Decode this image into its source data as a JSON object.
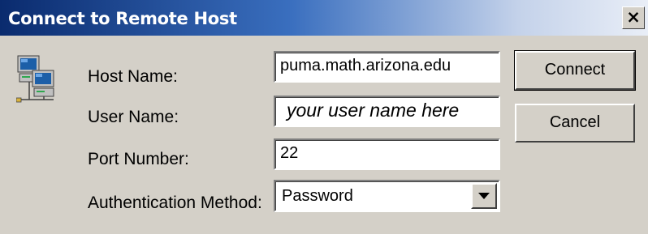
{
  "window": {
    "title": "Connect to Remote Host",
    "close_glyph": "×"
  },
  "form": {
    "host_label": "Host Name:",
    "host_value": "puma.math.arizona.edu",
    "user_label": "User Name:",
    "user_value": "your user name here",
    "port_label": "Port Number:",
    "port_value": "22",
    "auth_label": "Authentication Method:",
    "auth_value": "Password"
  },
  "buttons": {
    "connect": "Connect",
    "cancel": "Cancel"
  },
  "icons": {
    "host_icon": "network-computers-icon",
    "dropdown": "chevron-down-icon"
  }
}
